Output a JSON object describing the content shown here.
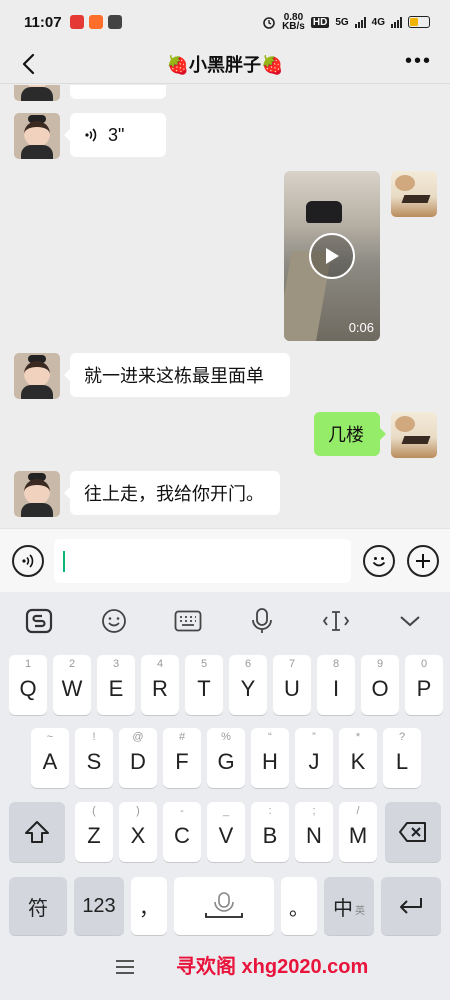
{
  "status": {
    "time": "11:07",
    "net_speed_top": "0.80",
    "net_speed_bottom": "KB/s",
    "hd": "HD",
    "sim1": "5G",
    "sim2": "4G"
  },
  "header": {
    "title": "🍓小黑胖子🍓"
  },
  "messages": [
    {
      "side": "left",
      "type": "voice",
      "text": "3\""
    },
    {
      "side": "right",
      "type": "video",
      "duration": "0:06"
    },
    {
      "side": "left",
      "type": "text",
      "text": "就一进来这栋最里面单"
    },
    {
      "side": "right",
      "type": "text",
      "text": "几楼"
    },
    {
      "side": "left",
      "type": "text",
      "text": "往上走，我给你开门。"
    }
  ],
  "keyboard": {
    "row1": [
      {
        "main": "Q",
        "sub": "1"
      },
      {
        "main": "W",
        "sub": "2"
      },
      {
        "main": "E",
        "sub": "3"
      },
      {
        "main": "R",
        "sub": "4"
      },
      {
        "main": "T",
        "sub": "5"
      },
      {
        "main": "Y",
        "sub": "6"
      },
      {
        "main": "U",
        "sub": "7"
      },
      {
        "main": "I",
        "sub": "8"
      },
      {
        "main": "O",
        "sub": "9"
      },
      {
        "main": "P",
        "sub": "0"
      }
    ],
    "row2": [
      {
        "main": "A",
        "sub": "~"
      },
      {
        "main": "S",
        "sub": "!"
      },
      {
        "main": "D",
        "sub": "@"
      },
      {
        "main": "F",
        "sub": "#"
      },
      {
        "main": "G",
        "sub": "%"
      },
      {
        "main": "H",
        "sub": "“"
      },
      {
        "main": "J",
        "sub": "”"
      },
      {
        "main": "K",
        "sub": "*"
      },
      {
        "main": "L",
        "sub": "?"
      }
    ],
    "row3": [
      {
        "main": "Z",
        "sub": "("
      },
      {
        "main": "X",
        "sub": ")"
      },
      {
        "main": "C",
        "sub": "-"
      },
      {
        "main": "V",
        "sub": "_"
      },
      {
        "main": "B",
        "sub": ":"
      },
      {
        "main": "N",
        "sub": ";"
      },
      {
        "main": "M",
        "sub": "/"
      }
    ],
    "symbols_label": "符",
    "numbers_label": "123",
    "comma_label": "，",
    "period_label": "。",
    "lang_label": "中",
    "lang_sub_label": "英"
  },
  "watermark": "寻欢阁 xhg2020.com",
  "colors": {
    "accent": "#0bb573",
    "bubble_right": "#95ec69",
    "watermark": "#e8143c"
  }
}
